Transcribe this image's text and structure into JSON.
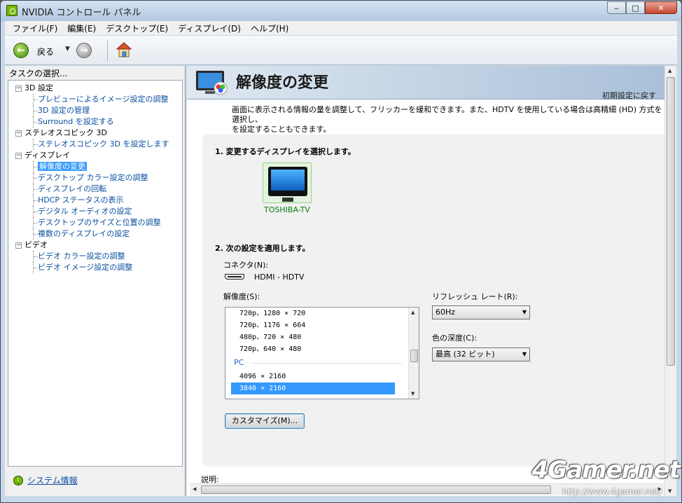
{
  "window": {
    "title": "NVIDIA コントロール パネル",
    "min": "‒",
    "max": "□",
    "close": "✕"
  },
  "menu": [
    "ファイル(F)",
    "編集(E)",
    "デスクトップ(E)",
    "ディスプレイ(D)",
    "ヘルプ(H)"
  ],
  "toolbar": {
    "back_label": "戻る",
    "back_glyph": "←",
    "fwd_glyph": "→",
    "dropdown_glyph": "▼"
  },
  "left": {
    "title": "タスクの選択...",
    "tree": [
      {
        "type": "cat",
        "label": "3D 設定",
        "toggle": "−"
      },
      {
        "type": "leaf",
        "label": "プレビューによるイメージ設定の調整"
      },
      {
        "type": "leaf",
        "label": "3D 設定の管理"
      },
      {
        "type": "leaf",
        "label": "Surround を設定する"
      },
      {
        "type": "cat",
        "label": "ステレオスコピック 3D",
        "toggle": "−"
      },
      {
        "type": "leaf",
        "label": "ステレオスコピック 3D を設定します"
      },
      {
        "type": "cat",
        "label": "ディスプレイ",
        "toggle": "−"
      },
      {
        "type": "leaf",
        "label": "解像度の変更",
        "selected": true
      },
      {
        "type": "leaf",
        "label": "デスクトップ カラー設定の調整"
      },
      {
        "type": "leaf",
        "label": "ディスプレイの回転"
      },
      {
        "type": "leaf",
        "label": "HDCP ステータスの表示"
      },
      {
        "type": "leaf",
        "label": "デジタル オーディオの設定"
      },
      {
        "type": "leaf",
        "label": "デスクトップのサイズと位置の調整"
      },
      {
        "type": "leaf",
        "label": "複数のディスプレイの設定"
      },
      {
        "type": "cat",
        "label": "ビデオ",
        "toggle": "−"
      },
      {
        "type": "leaf",
        "label": "ビデオ カラー設定の調整"
      },
      {
        "type": "leaf",
        "label": "ビデオ イメージ設定の調整"
      }
    ],
    "sysinfo": "システム情報",
    "sysinfo_glyph": "i"
  },
  "main": {
    "title": "解像度の変更",
    "restore": "初期設定に戻す",
    "description_1": "画面に表示される情報の量を調整して、フリッカーを緩和できます。また、HDTV を使用している場合は高精細 (HD) 方式を選択し、",
    "description_2": "を設定することもできます。",
    "step1": "1. 変更するディスプレイを選択します。",
    "display_name": "TOSHIBA-TV",
    "step2": "2. 次の設定を適用します。",
    "connector_label": "コネクタ(N):",
    "connector_value": "HDMI - HDTV",
    "resolution_label": "解像度(S):",
    "resolutions_hdtv": [
      "720p、1280 × 720",
      "720p、1176 × 664",
      "480p、720 × 480",
      "720p、640 × 480"
    ],
    "group_pc": "PC",
    "resolutions_pc": [
      "4096 × 2160",
      "3840 × 2160"
    ],
    "selected_resolution": "3840 × 2160",
    "refresh_label": "リフレッシュ レート(R):",
    "refresh_value": "60Hz",
    "depth_label": "色の深度(C):",
    "depth_value": "最高 (32 ビット)",
    "customize": "カスタマイズ(M)...",
    "explain": "説明:",
    "scroll_up": "▲",
    "scroll_down": "▼",
    "scroll_left": "◀",
    "scroll_right": "▶",
    "grip": "≡",
    "hgrip": "|||"
  },
  "watermark": {
    "logo": "4Gamer.net",
    "url": "http://www.4gamer.net/"
  }
}
